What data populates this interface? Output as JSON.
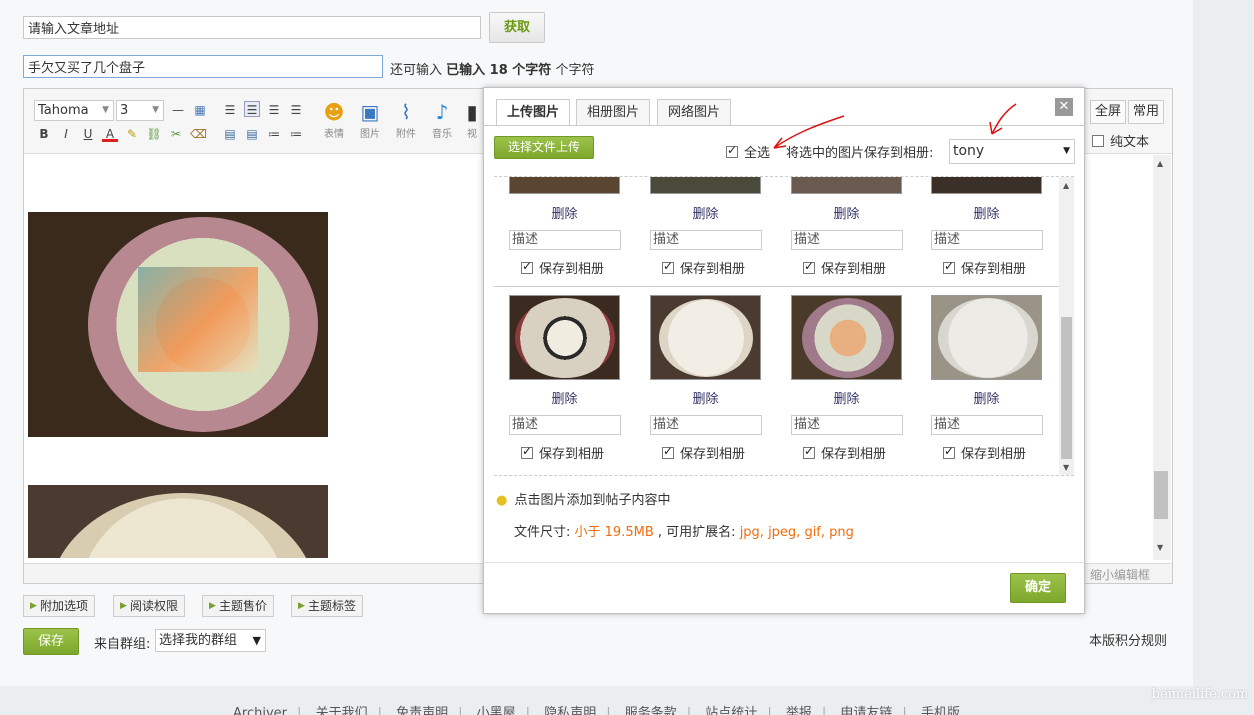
{
  "url_input": {
    "value": "请输入文章地址",
    "button": "获取"
  },
  "title_input": {
    "value": "手欠又买了几个盘子",
    "hint_prefix": "还可输入",
    "hint_bold": "已输入 18 个字符",
    "hint_suffix": "个字符"
  },
  "editor": {
    "font_family": "Tahoma",
    "font_size": "3",
    "big_tools": [
      "表情",
      "图片",
      "附件",
      "音乐",
      "视"
    ],
    "right_buttons": {
      "fullscreen": "全屏",
      "common": "常用"
    },
    "plain_text": "纯文本",
    "shrink": "缩小编辑框"
  },
  "bottom_tabs": [
    "附加选项",
    "阅读权限",
    "主题售价",
    "主题标签"
  ],
  "save_button": "保存",
  "group_label": "来自群组:",
  "group_select": "选择我的群组",
  "rules_link": "本版积分规则",
  "footer_links": [
    "Archiver",
    "关于我们",
    "免责声明",
    "小黑屋",
    "隐私声明",
    "服务条款",
    "站点统计",
    "举报",
    "申请友链",
    "手机版"
  ],
  "watermark": "beimeilife.com",
  "dialog": {
    "tabs": [
      "上传图片",
      "相册图片",
      "网络图片"
    ],
    "upload_button": "选择文件上传",
    "select_all": "全选",
    "save_to_album_label": "将选中的图片保存到相册:",
    "album_value": "tony",
    "delete_label": "删除",
    "desc_placeholder": "描述",
    "save_album_label": "保存到相册",
    "tip": "点击图片添加到帖子内容中",
    "file_size_label": "文件尺寸:",
    "file_size_value": "小于 19.5MB",
    "ext_label": ", 可用扩展名:",
    "ext_value": "jpg, jpeg, gif, png",
    "confirm": "确定"
  },
  "colors": {
    "accent_green": "#8ab23a",
    "orange": "#f26c0d",
    "annotation_red": "#e01010"
  }
}
